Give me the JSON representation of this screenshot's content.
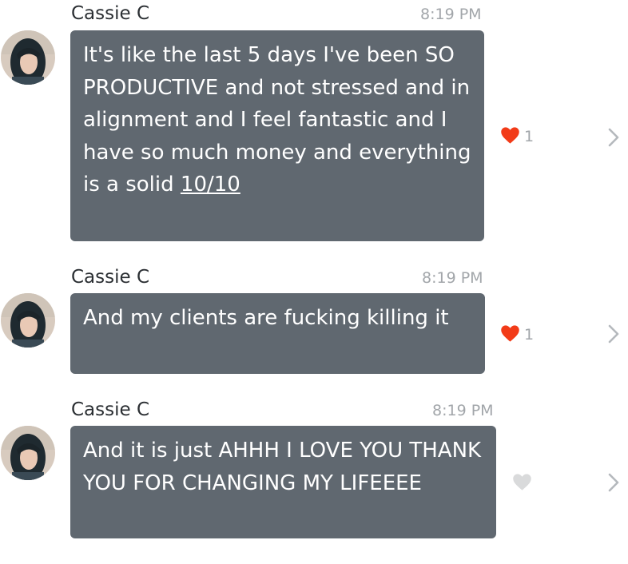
{
  "messages": [
    {
      "sender": "Cassie C",
      "time": "8:19 PM",
      "text_main": "It's like the last 5 days I've been SO PRODUCTIVE and not stressed and in alignment and I feel fantastic and I have so much money and everything is a solid",
      "text_link": "10/10",
      "liked": true,
      "like_count": "1",
      "avatar_icon": "avatar-photo",
      "like_icon": "heart-icon",
      "chevron_icon": "chevron-right-icon"
    },
    {
      "sender": "Cassie C",
      "time": "8:19 PM",
      "text_main": "And my clients are fucking killing it",
      "text_link": "",
      "liked": true,
      "like_count": "1",
      "avatar_icon": "avatar-photo",
      "like_icon": "heart-icon",
      "chevron_icon": "chevron-right-icon"
    },
    {
      "sender": "Cassie C",
      "time": "8:19 PM",
      "text_main": "And it is just AHHH I LOVE YOU THANK YOU FOR CHANGING MY LIFEEEE",
      "text_link": "",
      "liked": false,
      "like_count": "",
      "avatar_icon": "avatar-photo",
      "like_icon": "heart-icon",
      "chevron_icon": "chevron-right-icon"
    }
  ],
  "colors": {
    "bubble": "#606870",
    "heart_liked": "#f23b18",
    "heart_unliked": "#d9dadb",
    "muted_text": "#a2a6aa",
    "sender_text": "#2b2f33"
  }
}
